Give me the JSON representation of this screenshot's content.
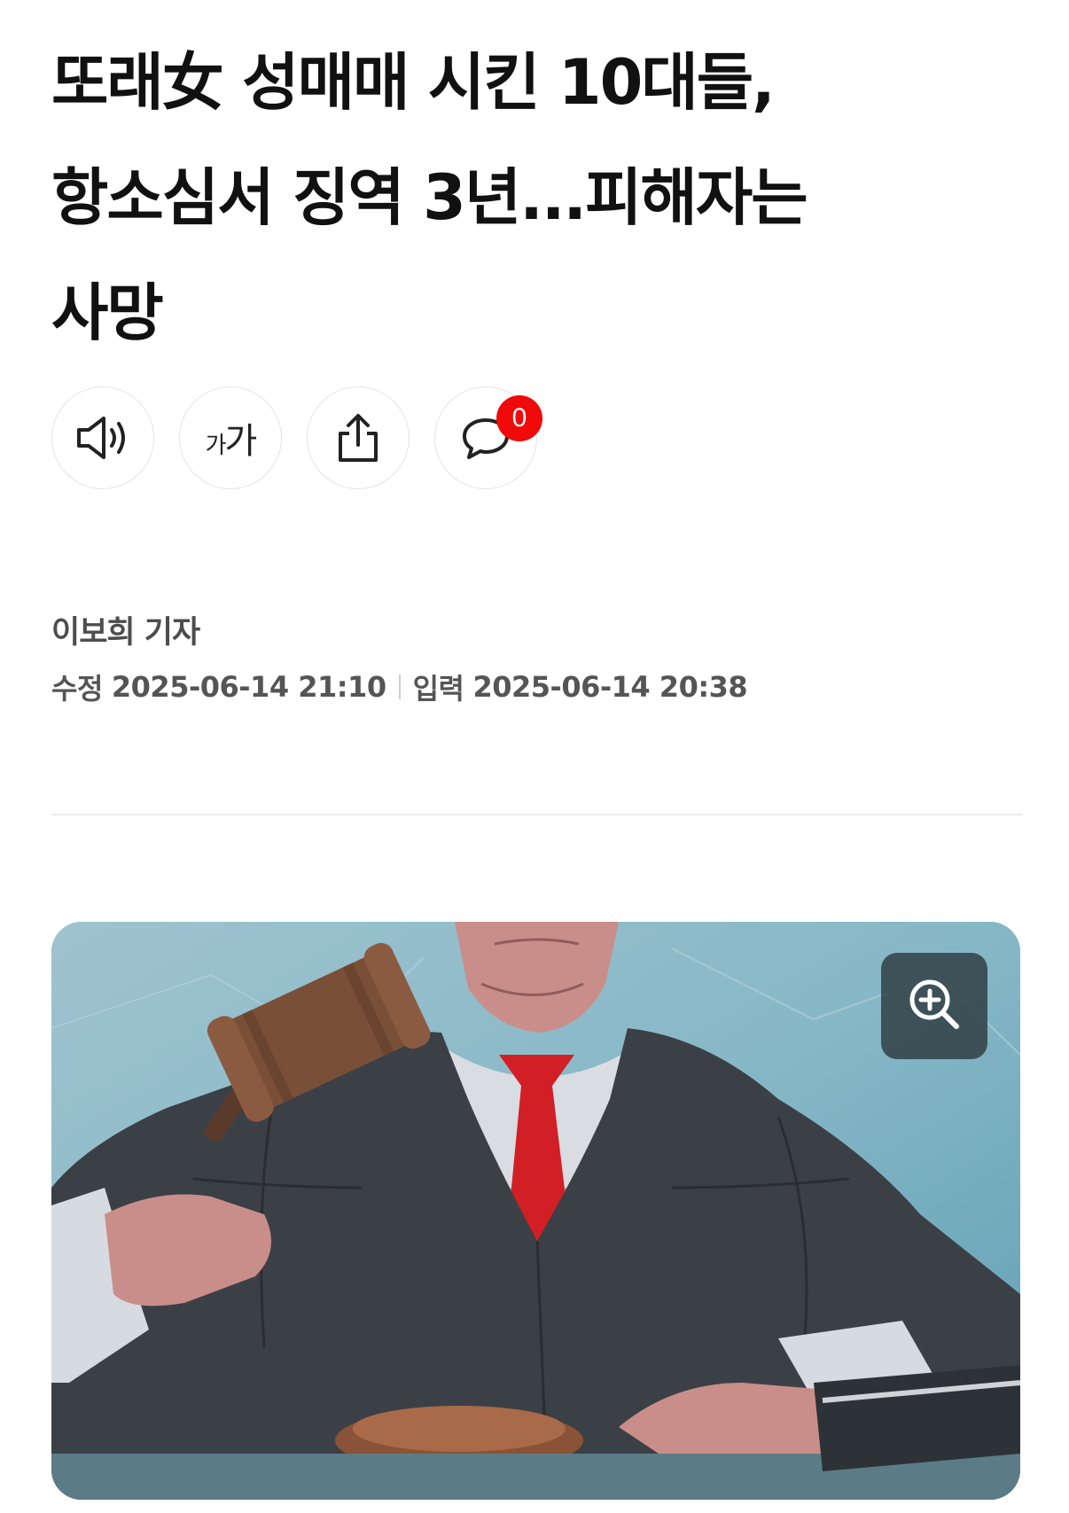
{
  "article": {
    "title_line1": "또래女 성매매 시킨 10대들,",
    "title_line2": "항소심서 징역 3년...피해자는",
    "title_line3": "사망",
    "author": "이보희 기자",
    "modified_label": "수정",
    "modified_datetime": "2025-06-14 21:10",
    "published_label": "입력",
    "published_datetime": "2025-06-14 20:38"
  },
  "toolbar": {
    "font_size_small": "가",
    "font_size_large": "가",
    "comment_count": "0"
  },
  "icons": {
    "listen": "speaker-icon",
    "font_size": "font-size-icon",
    "share": "share-icon",
    "comments": "comment-icon",
    "zoom": "zoom-in-icon"
  },
  "colors": {
    "badge": "#f00a0a",
    "meta_text": "#555555"
  }
}
